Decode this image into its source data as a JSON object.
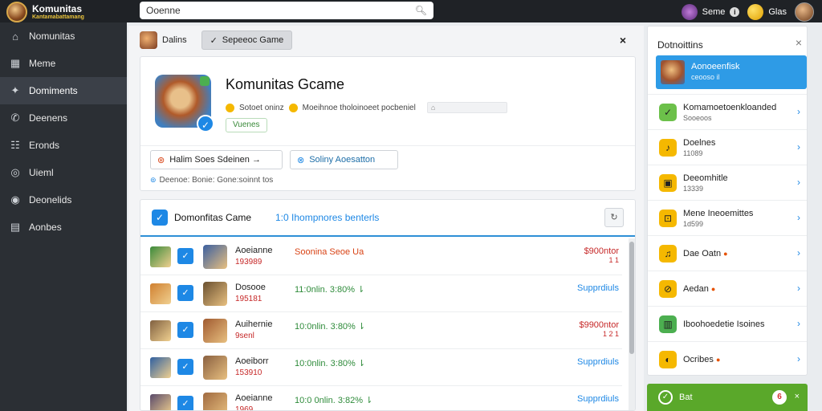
{
  "brand": {
    "name": "Komunitas",
    "subtitle": "Kantamabattamang"
  },
  "search": {
    "value": "Ooenne",
    "icon": "search-icon"
  },
  "topbar": {
    "user_label": "Seme",
    "coins_label": "Glas",
    "info_glyph": "i"
  },
  "sidebar": {
    "items": [
      {
        "label": "Nomunitas",
        "icon": "home-icon",
        "glyph": "⌂"
      },
      {
        "label": "Meme",
        "icon": "grid-icon",
        "glyph": "▦"
      },
      {
        "label": "Domiments",
        "icon": "star-icon",
        "glyph": "✦"
      },
      {
        "label": "Deenens",
        "icon": "phone-icon",
        "glyph": "✆"
      },
      {
        "label": "Eronds",
        "icon": "group-icon",
        "glyph": "☷"
      },
      {
        "label": "Uieml",
        "icon": "circle-icon",
        "glyph": "◎"
      },
      {
        "label": "Deonelids",
        "icon": "settings-icon",
        "glyph": "◉"
      },
      {
        "label": "Aonbes",
        "icon": "doc-icon",
        "glyph": "▤"
      }
    ]
  },
  "tabs": [
    {
      "label": "Dalins"
    },
    {
      "label": "Sepeeoc Game",
      "glyph": "✓"
    }
  ],
  "tab_close": "×",
  "game": {
    "title": "Komunitas Gcame",
    "meta_a": "Sotoet oninz",
    "meta_b": "Moeihnoe tholoinoeet pocbeniel",
    "meta_box": "⌂",
    "status": "Vuenes",
    "badge_glyph": "✓",
    "btn_a": "Halim Soes Sdeinen →",
    "btn_a_glyph": "⊛",
    "btn_b": "Soliny Aoesatton",
    "btn_b_glyph": "⊗",
    "footer": "Deenoe: Bonie: Gone:soinnt tos",
    "footer_glyph": "⊚"
  },
  "list": {
    "title": "Domonfitas Came",
    "subtitle": "1:0 Ihompnores benterls",
    "check_glyph": "✓",
    "refresh_glyph": "↻",
    "rows": [
      {
        "name": "Aoeianne",
        "id": "193989",
        "desc": "Soonina Seoe Ua",
        "desc_color": "red",
        "price": "$900ntor",
        "price_sub": "1 1",
        "price_color": "red",
        "thumb1": "#3a8a3a",
        "thumb2": "#3a5fa0"
      },
      {
        "name": "Dosooe",
        "id": "195181",
        "desc": "11:0nlin. 3:80% ⇂",
        "desc_color": "green",
        "price": "Supprdiuls",
        "price_sub": "",
        "price_color": "blue",
        "thumb1": "#d08030",
        "thumb2": "#6a5030"
      },
      {
        "name": "Auihernie",
        "id": "9senl",
        "desc": "10:0nlin. 3:80% ⇂",
        "desc_color": "green",
        "price": "$9900ntor",
        "price_sub": "1 2 1",
        "price_color": "red",
        "thumb1": "#806040",
        "thumb2": "#a05a30"
      },
      {
        "name": "Aoeiborr",
        "id": "153910",
        "desc": "10:0nlin. 3:80% ⇂",
        "desc_color": "green",
        "price": "Supprdiuls",
        "price_sub": "",
        "price_color": "blue",
        "thumb1": "#3060a0",
        "thumb2": "#8a6040"
      },
      {
        "name": "Aoeianne",
        "id": "1969",
        "desc": "10:0 0nlin. 3:82% ⇂",
        "desc_color": "green",
        "price": "Supprdiuls",
        "price_sub": "",
        "price_color": "blue",
        "thumb1": "#5a4a6a",
        "thumb2": "#a06a40"
      }
    ]
  },
  "rpanel": {
    "title": "Dotnoittins",
    "close_glyph": "×",
    "active": {
      "title": "Aonoeenfisk",
      "sub": "ceooso il"
    },
    "items": [
      {
        "l1": "Komamoetoenkloanded",
        "l2": "Sooeoos",
        "color": "#6cc04a",
        "glyph": "✓"
      },
      {
        "l1": "Doelnes",
        "l2": "11089",
        "color": "#f5b800",
        "glyph": "♪"
      },
      {
        "l1": "Deeomhitle",
        "l2": "13339",
        "color": "#f5b800",
        "glyph": "▣"
      },
      {
        "l1": "Mene Ineoemittes",
        "l2": "1d599",
        "color": "#f5b800",
        "glyph": "⊡"
      },
      {
        "l1": "Dae Oatn",
        "l2": "",
        "color": "#f5b800",
        "glyph": "♫",
        "fire": "●"
      },
      {
        "l1": "Aedan",
        "l2": "",
        "color": "#f5b800",
        "glyph": "⊘",
        "fire": "●"
      },
      {
        "l1": "Iboohoedetie Isoines",
        "l2": "",
        "color": "#4caf50",
        "glyph": "▥"
      },
      {
        "l1": "Ocribes",
        "l2": "",
        "color": "#f5b800",
        "glyph": "◐",
        "fire": "●"
      }
    ],
    "arrow_glyph": "›",
    "green_label": "Bat",
    "green_glyph": "✓",
    "green_badge": "6",
    "green_x": "×"
  }
}
